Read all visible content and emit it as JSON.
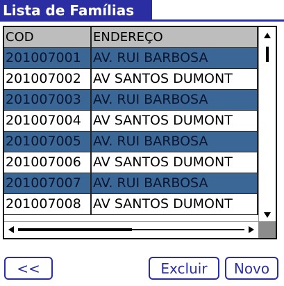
{
  "window": {
    "title": "Lista de Famílias"
  },
  "table": {
    "columns": [
      "COD",
      "ENDEREÇO"
    ],
    "rows": [
      {
        "cod": "201007001",
        "endereco": "AV. RUI BARBOSA"
      },
      {
        "cod": "201007002",
        "endereco": "AV SANTOS DUMONT"
      },
      {
        "cod": "201007003",
        "endereco": "AV. RUI BARBOSA"
      },
      {
        "cod": "201007004",
        "endereco": "AV SANTOS DUMONT"
      },
      {
        "cod": "201007005",
        "endereco": "AV. RUI BARBOSA"
      },
      {
        "cod": "201007006",
        "endereco": "AV SANTOS DUMONT"
      },
      {
        "cod": "201007007",
        "endereco": "AV. RUI BARBOSA"
      },
      {
        "cod": "201007008",
        "endereco": "AV SANTOS DUMONT"
      }
    ]
  },
  "buttons": {
    "back": "<<",
    "excluir": "Excluir",
    "novo": "Novo"
  },
  "colors": {
    "accent": "#2b2ea3",
    "highlight_row": "#3a6795",
    "header_row": "#bdbdbd"
  }
}
